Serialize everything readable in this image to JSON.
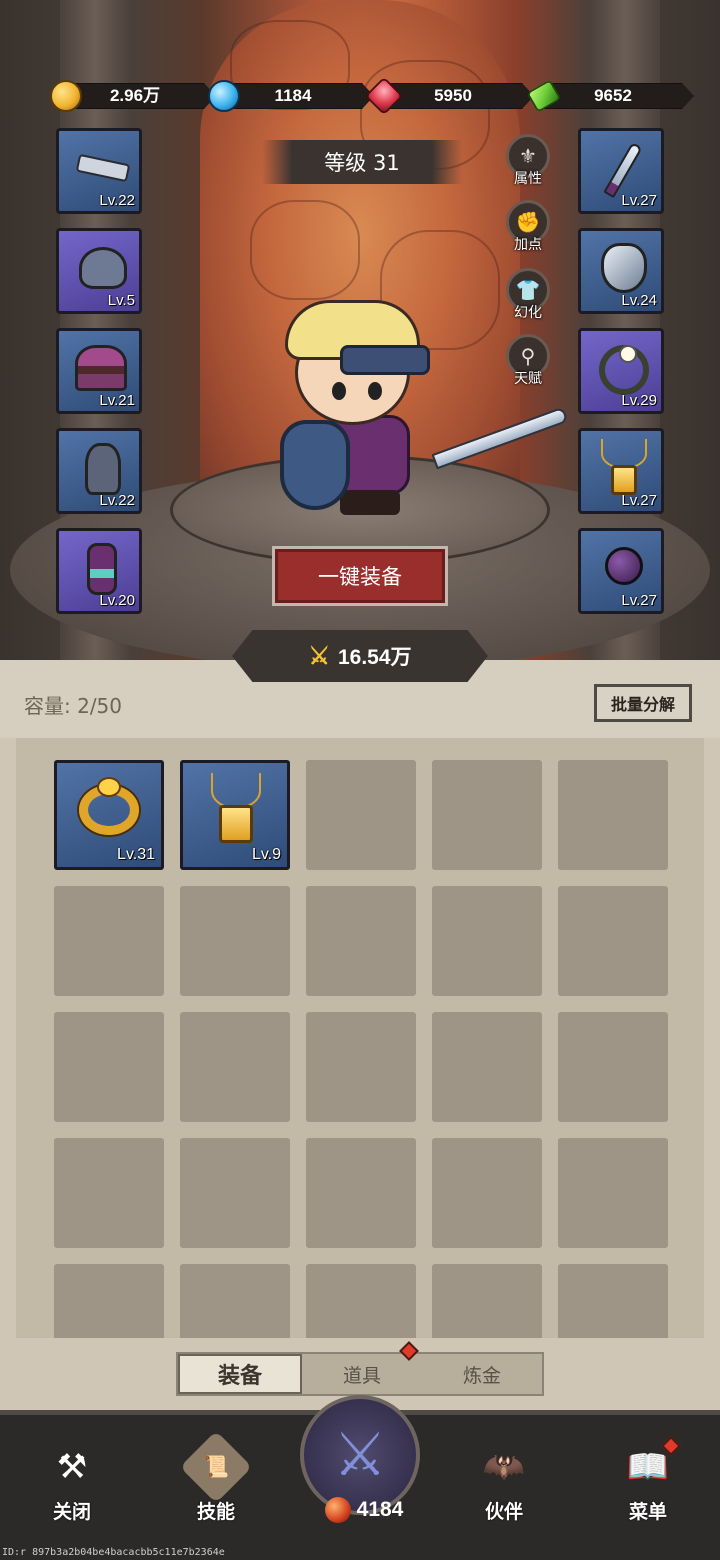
{
  "currencies": [
    {
      "name": "gold",
      "value": "2.96万",
      "color": "#f2b531"
    },
    {
      "name": "diamond",
      "value": "1184",
      "color": "#3db4ee"
    },
    {
      "name": "ruby",
      "value": "5950",
      "color": "#e23d4f"
    },
    {
      "name": "cash",
      "value": "9652",
      "color": "#6fcf3a"
    }
  ],
  "level": "等级 31",
  "left_slots": [
    {
      "item": "glove-icon",
      "level": "Lv.22",
      "rarity": "blue"
    },
    {
      "item": "helmet-icon",
      "level": "Lv.5",
      "rarity": "purple"
    },
    {
      "item": "hat-icon",
      "level": "Lv.21",
      "rarity": "blue"
    },
    {
      "item": "armor-icon",
      "level": "Lv.22",
      "rarity": "blue"
    },
    {
      "item": "boots-icon",
      "level": "Lv.20",
      "rarity": "purple"
    }
  ],
  "right_slots": [
    {
      "item": "sword-icon",
      "level": "Lv.27",
      "rarity": "blue"
    },
    {
      "item": "shield-icon",
      "level": "Lv.24",
      "rarity": "blue"
    },
    {
      "item": "wreath-icon",
      "level": "Lv.29",
      "rarity": "purple"
    },
    {
      "item": "necklace-icon",
      "level": "Lv.27",
      "rarity": "blue"
    },
    {
      "item": "spiked-orb-icon",
      "level": "Lv.27",
      "rarity": "blue"
    }
  ],
  "side_buttons": [
    {
      "label": "属性",
      "icon": "attribute-icon"
    },
    {
      "label": "加点",
      "icon": "fist-icon"
    },
    {
      "label": "幻化",
      "icon": "shirt-icon"
    },
    {
      "label": "天赋",
      "icon": "talent-tree-icon"
    }
  ],
  "equip_all_label": "一键装备",
  "power_value": "16.54万",
  "capacity_label": "容量: 2/50",
  "batch_button_label": "批量分解",
  "inventory_items": [
    {
      "item": "ring-icon",
      "level": "Lv.31"
    },
    {
      "item": "necklace-icon",
      "level": "Lv.9"
    }
  ],
  "tabs": [
    {
      "label": "装备",
      "active": true
    },
    {
      "label": "道具",
      "active": false,
      "notification": true
    },
    {
      "label": "炼金",
      "active": false
    }
  ],
  "nav": {
    "close": "关闭",
    "skills": "技能",
    "battle_value": "4184",
    "partner": "伙伴",
    "menu": "菜单"
  },
  "footer_id": "ID:r 897b3a2b04be4bacacbb5c11e7b2364e"
}
